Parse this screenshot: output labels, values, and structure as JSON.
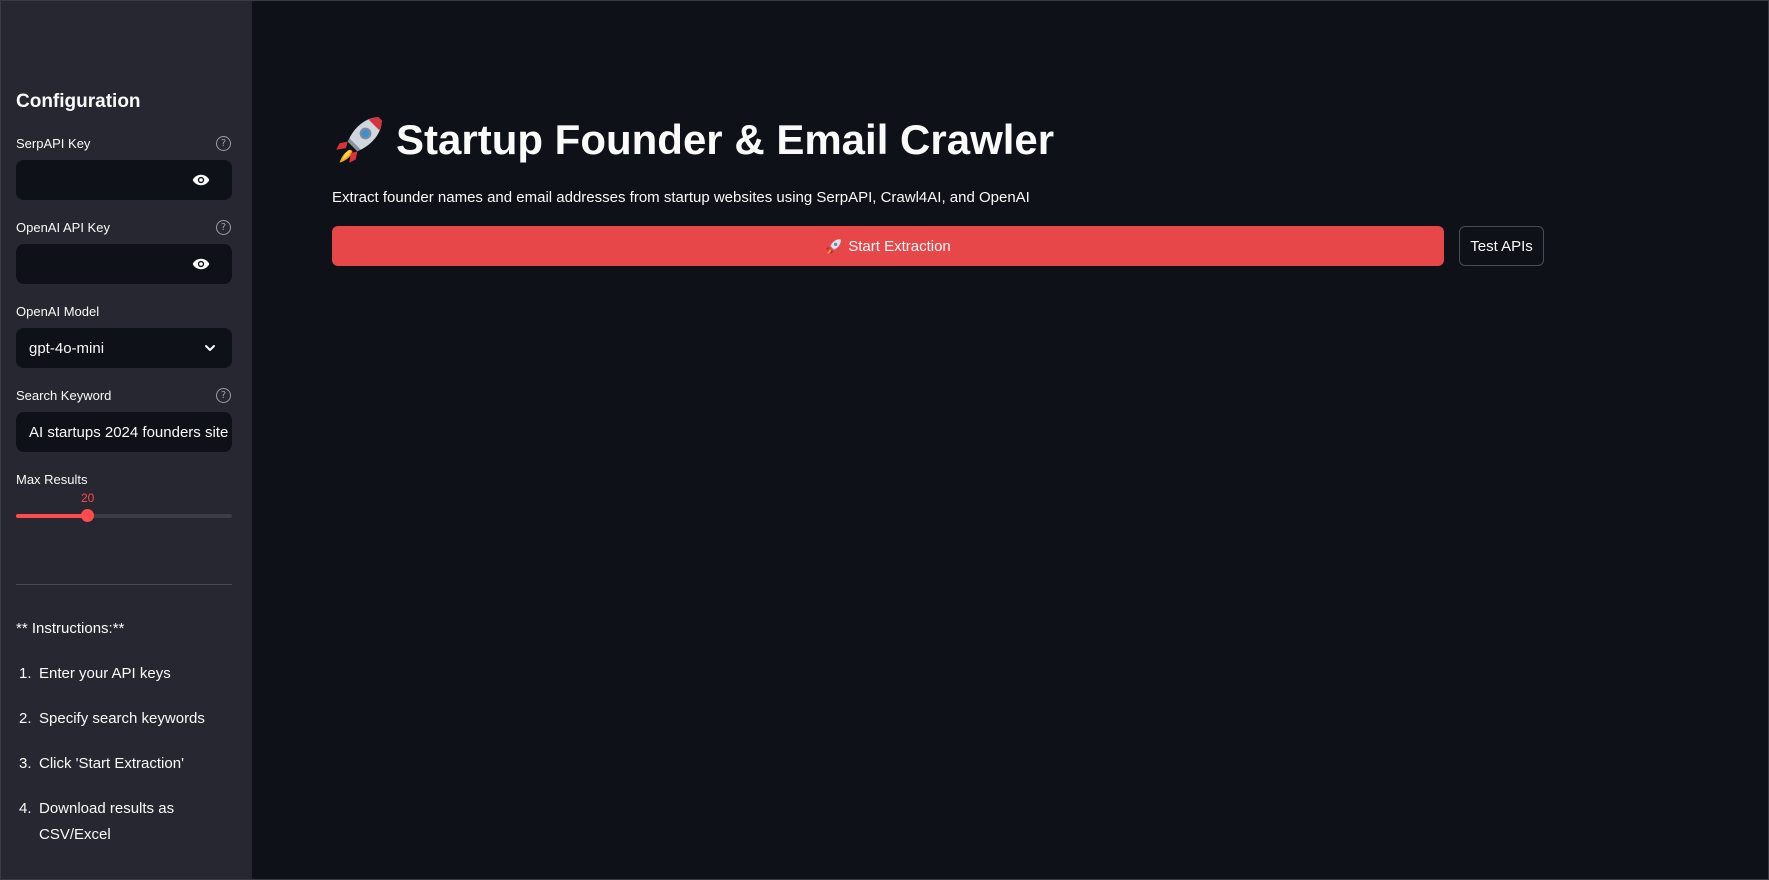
{
  "sidebar": {
    "heading": "Configuration",
    "serpapi": {
      "label": "SerpAPI Key",
      "value": ""
    },
    "openai_key": {
      "label": "OpenAI API Key",
      "value": ""
    },
    "model": {
      "label": "OpenAI Model",
      "selected": "gpt-4o-mini"
    },
    "keyword": {
      "label": "Search Keyword",
      "value": "AI startups 2024 founders site"
    },
    "max_results": {
      "label": "Max Results",
      "value": "20",
      "fraction": 0.33
    },
    "instructions": {
      "title": "** Instructions:**",
      "items": [
        {
          "num": "1.",
          "text": "Enter your API keys"
        },
        {
          "num": "2.",
          "text": "Specify search keywords"
        },
        {
          "num": "3.",
          "text": "Click 'Start Extraction'"
        },
        {
          "num": "4.",
          "text": "Download results as CSV/Excel"
        }
      ]
    },
    "help_glyph": "?"
  },
  "main": {
    "title": "Startup Founder & Email Crawler",
    "subtitle": "Extract founder names and email addresses from startup websites using SerpAPI, Crawl4AI, and OpenAI",
    "start_button": "Start Extraction",
    "test_button": "Test APIs"
  },
  "colors": {
    "accent": "#ff4b4b",
    "button": "#e8474a",
    "sidebar_bg": "#262730",
    "main_bg": "#0e1117"
  }
}
